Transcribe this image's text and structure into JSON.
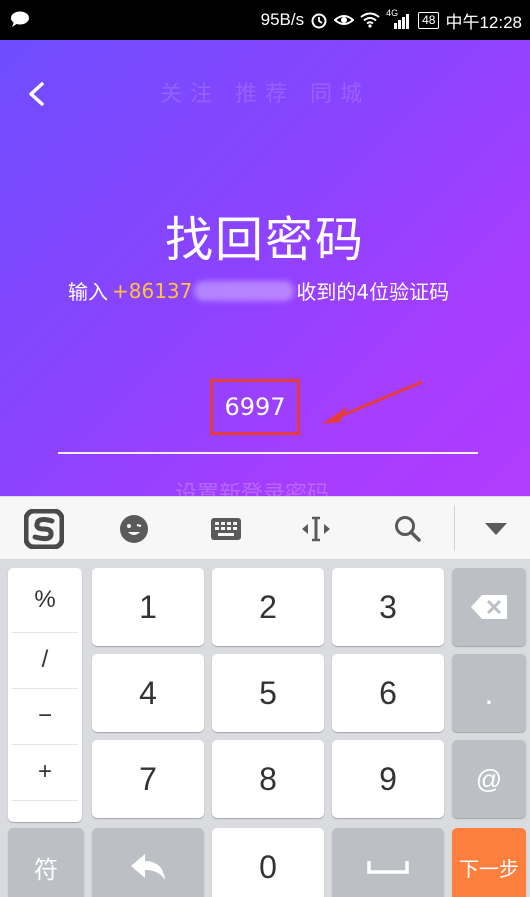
{
  "status_bar": {
    "speed": "95B/s",
    "network": "4G",
    "battery": "48",
    "time": "中午12:28",
    "icons": [
      "chat-bubble-icon",
      "alarm-icon",
      "eye-icon",
      "wifi-icon",
      "signal-icon",
      "battery-icon"
    ]
  },
  "background_text": {
    "tabs": "关注  推荐  同城",
    "next_field_placeholder": "设置新登录密码"
  },
  "header": {
    "title": "找回密码"
  },
  "verify": {
    "prefix": "输入",
    "phone": "+86137",
    "suffix": "收到的4位验证码",
    "code": "6997"
  },
  "keyboard_toolbar": {
    "icons": [
      "sogou-logo-icon",
      "emoji-icon",
      "keyboard-icon",
      "cursor-move-icon",
      "search-icon",
      "collapse-keyboard-icon"
    ]
  },
  "keypad": {
    "symbols": [
      "%",
      "/",
      "−",
      "+"
    ],
    "digits": [
      "1",
      "2",
      "3",
      "4",
      "5",
      "6",
      "7",
      "8",
      "9",
      "0"
    ],
    "dot": ".",
    "at": "@",
    "symbols_key": "符",
    "next": "下一步"
  },
  "colors": {
    "gradient_start": "#6f4dff",
    "gradient_end": "#b13cff",
    "phone_highlight": "#ffc23a",
    "annotation_red": "#e63b3b",
    "next_button": "#ff7f3f"
  }
}
